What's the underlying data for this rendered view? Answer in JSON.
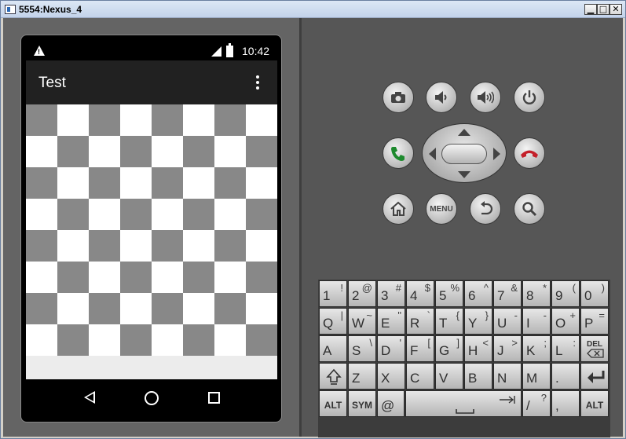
{
  "window": {
    "title": "5554:Nexus_4",
    "controls": {
      "minimize": "▁",
      "restore": "□",
      "close": "✕"
    }
  },
  "phone": {
    "status_bar": {
      "time": "10:42",
      "warning_icon": "warning-icon",
      "signal_icon": "signal-icon",
      "battery_icon": "battery-icon"
    },
    "app_bar": {
      "title": "Test",
      "overflow_icon": "more-vert-icon"
    },
    "checkerboard": {
      "rows": 8,
      "cols": 8,
      "dark_color": "#888888",
      "light_color": "#ffffff"
    },
    "nav_bar": {
      "back_icon": "back-icon",
      "home_icon": "home-circle-icon",
      "recents_icon": "recents-square-icon"
    }
  },
  "hardware": {
    "row1": [
      "camera-icon",
      "volume-down-icon",
      "volume-up-icon",
      "power-icon"
    ],
    "call_icon": "call-icon",
    "end_call_icon": "end-call-icon",
    "row3": {
      "home": "home-icon",
      "menu_label": "MENU",
      "back": "back-icon",
      "search": "search-icon"
    }
  },
  "keyboard": {
    "rows": [
      [
        {
          "main": "1",
          "alt": "!"
        },
        {
          "main": "2",
          "alt": "@"
        },
        {
          "main": "3",
          "alt": "#"
        },
        {
          "main": "4",
          "alt": "$"
        },
        {
          "main": "5",
          "alt": "%"
        },
        {
          "main": "6",
          "alt": "^"
        },
        {
          "main": "7",
          "alt": "&"
        },
        {
          "main": "8",
          "alt": "*"
        },
        {
          "main": "9",
          "alt": "("
        },
        {
          "main": "0",
          "alt": ")"
        }
      ],
      [
        {
          "main": "Q",
          "alt": "|"
        },
        {
          "main": "W",
          "alt": "~"
        },
        {
          "main": "E",
          "alt": "\""
        },
        {
          "main": "R",
          "alt": "`"
        },
        {
          "main": "T",
          "alt": "{"
        },
        {
          "main": "Y",
          "alt": "}"
        },
        {
          "main": "U",
          "alt": "-"
        },
        {
          "main": "I",
          "alt": "-"
        },
        {
          "main": "O",
          "alt": "+"
        },
        {
          "main": "P",
          "alt": "="
        }
      ],
      [
        {
          "main": "A",
          "alt": ""
        },
        {
          "main": "S",
          "alt": "\\"
        },
        {
          "main": "D",
          "alt": "'"
        },
        {
          "main": "F",
          "alt": "["
        },
        {
          "main": "G",
          "alt": "]"
        },
        {
          "main": "H",
          "alt": "<"
        },
        {
          "main": "J",
          "alt": ">"
        },
        {
          "main": "K",
          "alt": ";"
        },
        {
          "main": "L",
          "alt": ":"
        },
        {
          "main": "DEL",
          "alt": ""
        }
      ],
      [
        {
          "main": "shift-icon",
          "alt": ""
        },
        {
          "main": "Z",
          "alt": ""
        },
        {
          "main": "X",
          "alt": ""
        },
        {
          "main": "C",
          "alt": ""
        },
        {
          "main": "V",
          "alt": ""
        },
        {
          "main": "B",
          "alt": ""
        },
        {
          "main": "N",
          "alt": ""
        },
        {
          "main": "M",
          "alt": ""
        },
        {
          "main": ".",
          "alt": ""
        },
        {
          "main": "enter-icon",
          "alt": ""
        }
      ],
      [
        {
          "main": "ALT",
          "alt": ""
        },
        {
          "main": "SYM",
          "alt": ""
        },
        {
          "main": "@",
          "alt": ""
        },
        {
          "main": "space-icon",
          "alt": ""
        },
        {
          "main": "/",
          "alt": "?"
        },
        {
          "main": ",",
          "alt": ""
        },
        {
          "main": "ALT",
          "alt": ""
        }
      ]
    ]
  }
}
